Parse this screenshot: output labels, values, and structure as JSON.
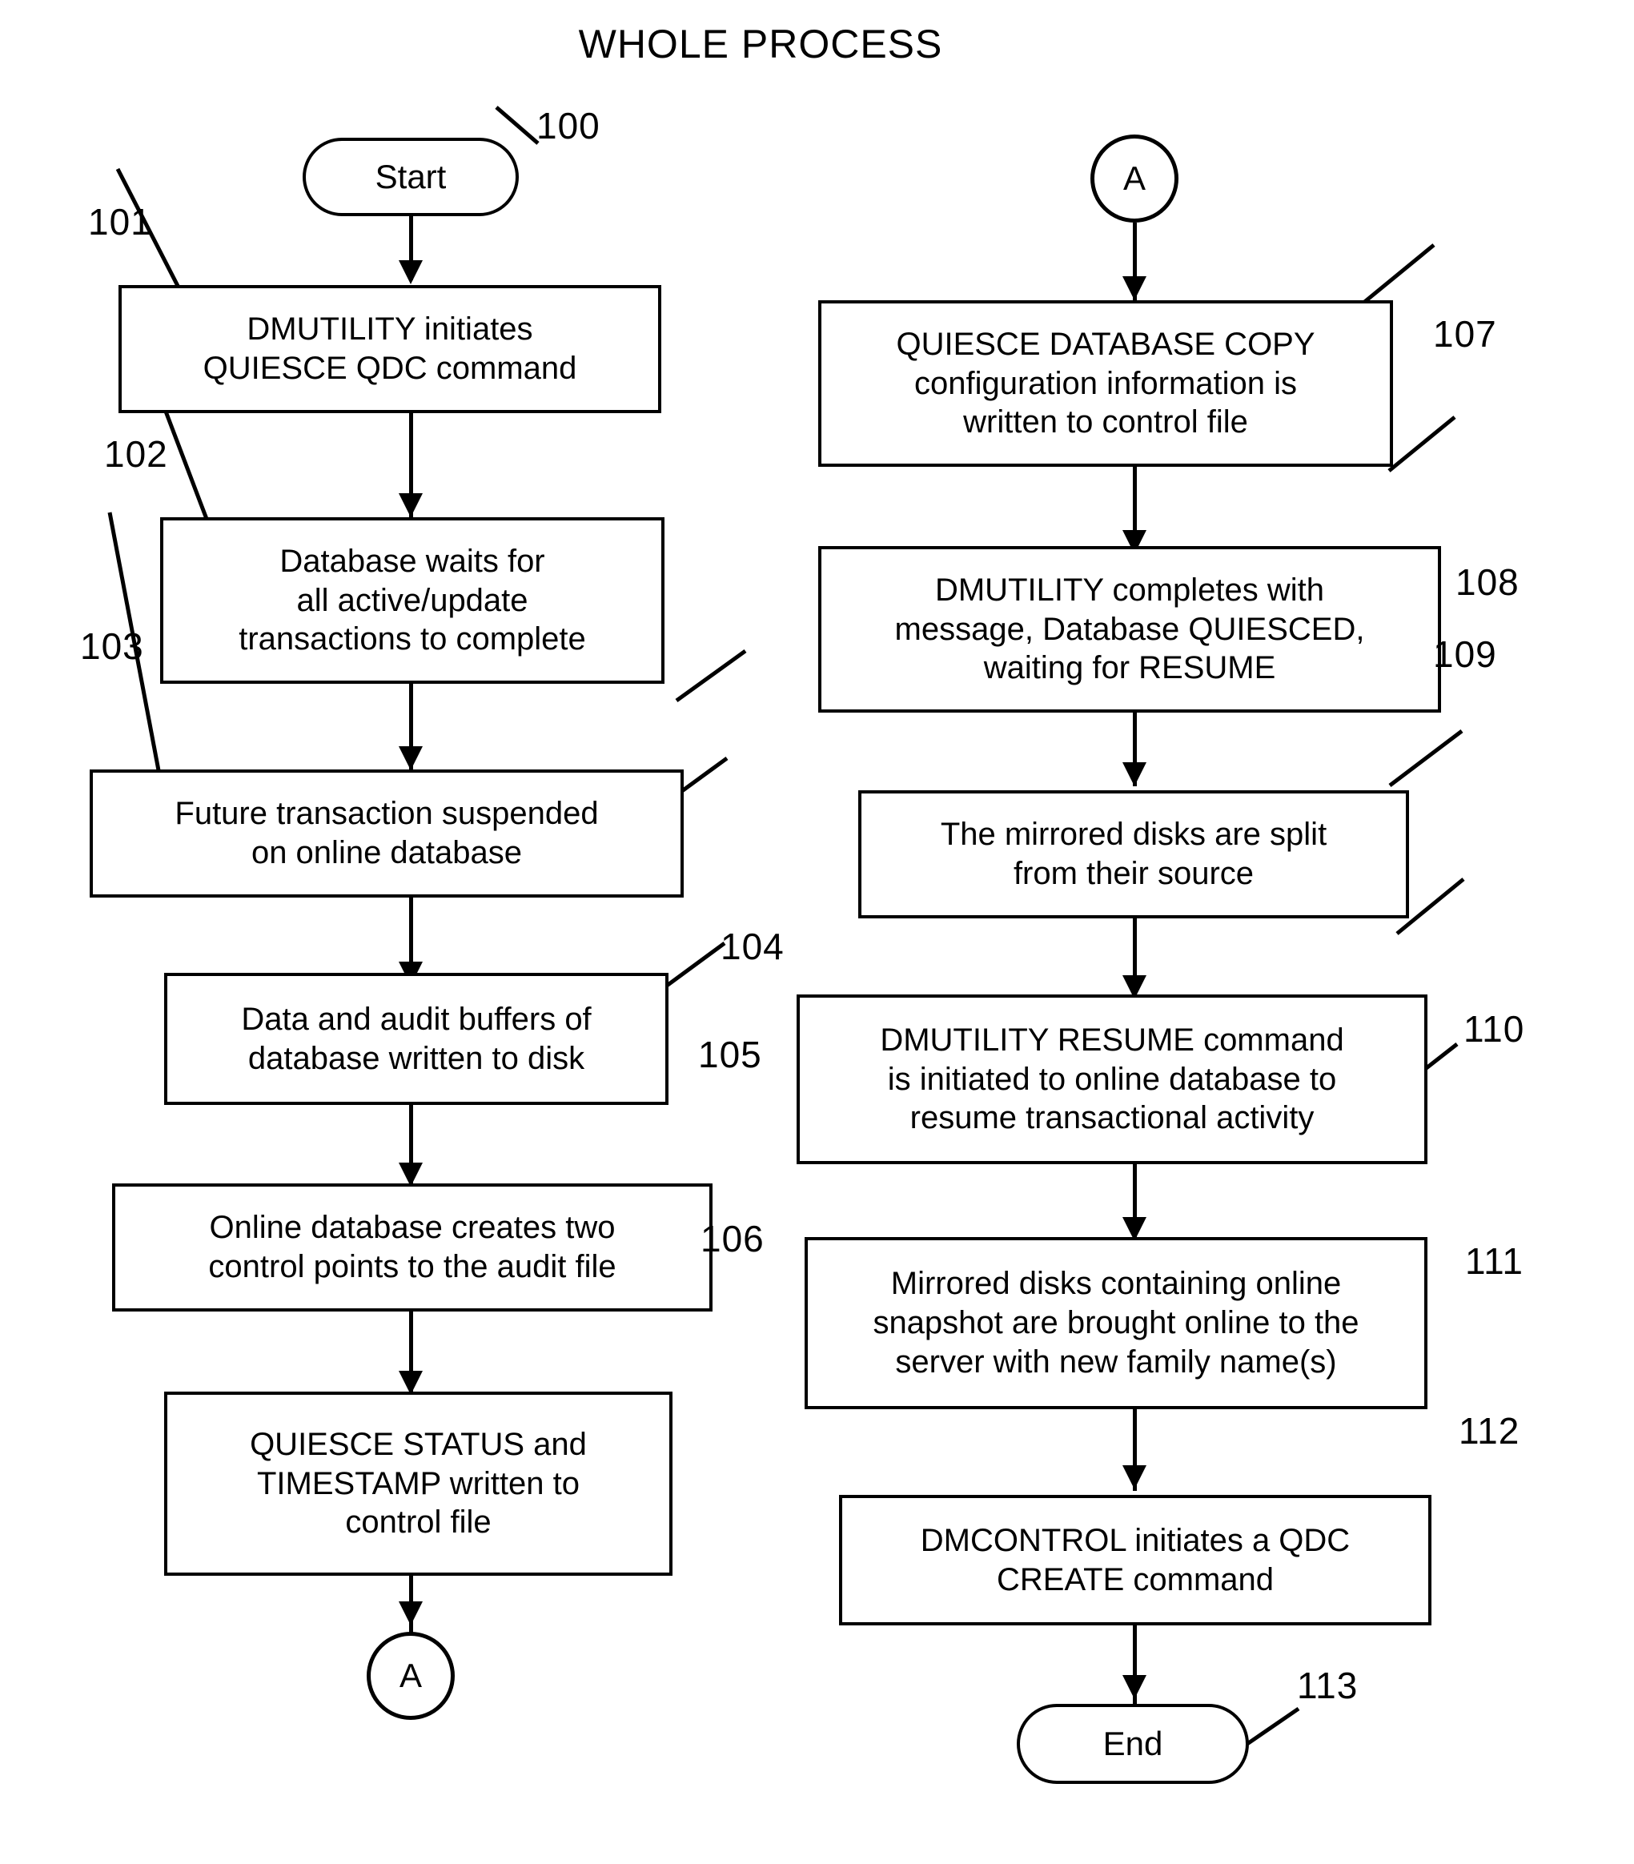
{
  "figure": {
    "title": "WHOLE PROCESS",
    "type": "flowchart"
  },
  "nodes": {
    "start": {
      "label": "Start",
      "ref": "100",
      "shape": "terminator"
    },
    "n101": {
      "label": "DMUTILITY initiates\nQUIESCE QDC command",
      "ref": "101",
      "shape": "process"
    },
    "n102": {
      "label": "Database waits for\nall active/update\ntransactions to complete",
      "ref": "102",
      "shape": "process"
    },
    "n103": {
      "label": "Future transaction suspended\non online database",
      "ref": "103",
      "shape": "process"
    },
    "n104": {
      "label": "Data and audit buffers of\ndatabase written to disk",
      "ref": "104",
      "shape": "process"
    },
    "n105": {
      "label": "Online database creates two\ncontrol points to the audit file",
      "ref": "105",
      "shape": "process"
    },
    "n106": {
      "label": "QUIESCE STATUS and\nTIMESTAMP written to\ncontrol file",
      "ref": "106",
      "shape": "process"
    },
    "connector_a_out": {
      "label": "A",
      "shape": "connector"
    },
    "connector_a_in": {
      "label": "A",
      "shape": "connector"
    },
    "n107": {
      "label": "QUIESCE DATABASE COPY\nconfiguration information is\nwritten to control file",
      "ref": "107",
      "shape": "process"
    },
    "n108": {
      "label": "DMUTILITY completes with\nmessage, Database QUIESCED,\nwaiting for RESUME",
      "ref": "108",
      "shape": "process"
    },
    "n109": {
      "label": "The mirrored disks are split\nfrom their source",
      "ref": "109",
      "shape": "process"
    },
    "n110": {
      "label": "DMUTILITY RESUME command\nis initiated to online database to\nresume transactional activity",
      "ref": "110",
      "shape": "process"
    },
    "n111": {
      "label": "Mirrored disks containing online\nsnapshot are brought online to the\nserver with new family name(s)",
      "ref": "111",
      "shape": "process"
    },
    "n112": {
      "label": "DMCONTROL initiates a QDC\nCREATE command",
      "ref": "112",
      "shape": "process"
    },
    "end": {
      "label": "End",
      "ref": "113",
      "shape": "terminator"
    }
  },
  "colors": {
    "ink": "#000000",
    "paper": "#ffffff"
  }
}
